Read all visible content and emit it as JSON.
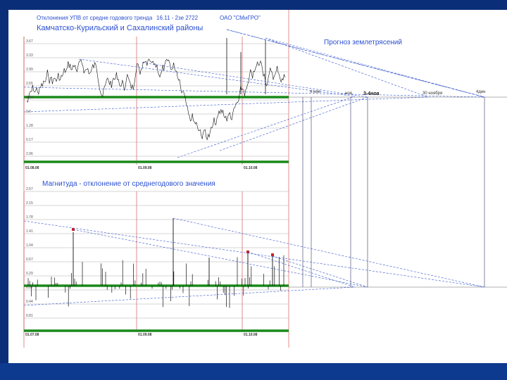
{
  "slide": {
    "background": "#0a2f78",
    "stripe": "#0d3a8e",
    "content_bg": "#ffffff"
  },
  "chart_data": [
    {
      "type": "line",
      "title_line1": "Отклонения УПВ от средне годового тренда",
      "title_line1_extra": "16.11 - 2зе  2722",
      "title_line1_org": "ОАО \"СМиГРО\"",
      "title_line2": "Камчатско-Курильский и Сахалинский районы",
      "yticks": [
        "3.67",
        "3.33",
        "2.99",
        "2.65",
        "2.31",
        "0.6",
        "1.28",
        "0.17",
        "2.96"
      ],
      "xticks": [
        "01.08.08",
        "01.09.08",
        "01.10.08"
      ],
      "baseline_color": "#1a8a1a",
      "series_color": "#111111",
      "trend_color": "#3355cc"
    },
    {
      "type": "bar",
      "title": "Магнитуда - отклонение от среднегодового значения",
      "yticks": [
        "2.57",
        "2.15",
        "1.78",
        "1.41",
        "1.04",
        "0.67",
        "0.29",
        "0.07",
        "0.44",
        "0.81"
      ],
      "xticks": [
        "01.07.08",
        "01.09.08",
        "01.10.08"
      ],
      "baseline_color": "#1a8a1a",
      "series_color": "#111111",
      "marker_color": "#cc2222"
    }
  ],
  "forecast": {
    "title": "Прогноз землетрясений",
    "labels": [
      "4 ноя",
      "ноя",
      "3-4ноя",
      "30 ноября",
      "4ден"
    ]
  }
}
